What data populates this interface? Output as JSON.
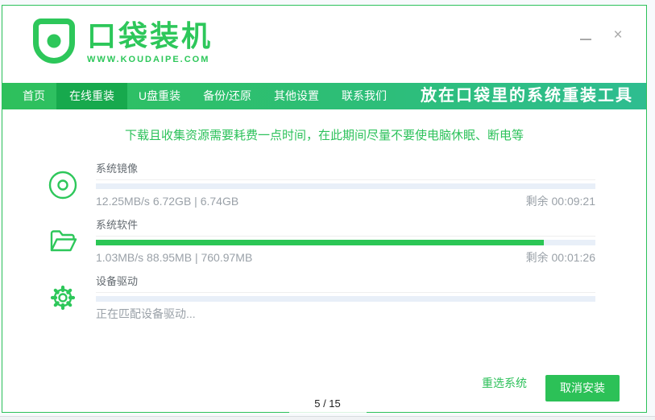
{
  "window": {
    "brand": {
      "title": "口袋装机",
      "url": "WWW.KOUDAIPE.COM"
    },
    "controls": {
      "close_icon": "×"
    }
  },
  "nav": {
    "tabs": [
      {
        "label": "首页",
        "active": false
      },
      {
        "label": "在线重装",
        "active": true
      },
      {
        "label": "U盘重装",
        "active": false
      },
      {
        "label": "备份/还原",
        "active": false
      },
      {
        "label": "其他设置",
        "active": false
      },
      {
        "label": "联系我们",
        "active": false
      }
    ],
    "slogan": "放在口袋里的系统重装工具"
  },
  "notice": "下载且收集资源需要耗费一点时间，在此期间尽量不要使电脑休眠、断电等",
  "tasks": [
    {
      "icon": "disc-icon",
      "title": "系统镜像",
      "status": "12.25MB/s 6.72GB | 6.74GB",
      "remaining": "剩余 00:09:21",
      "progress": 0
    },
    {
      "icon": "folder-icon",
      "title": "系统软件",
      "status": "1.03MB/s 88.95MB | 760.97MB",
      "remaining": "剩余 00:01:26",
      "progress": 89.6
    },
    {
      "icon": "gear-icon",
      "title": "设备驱动",
      "status": "正在匹配设备驱动...",
      "remaining": "",
      "progress": 0
    }
  ],
  "footer": {
    "reselect_label": "重选系统",
    "cancel_label": "取消安装",
    "pagination": "5 / 15"
  },
  "colors": {
    "accent_green": "#2dc75a",
    "nav_gradient_left": "#2ec05c",
    "nav_gradient_right": "#2ebd90",
    "active_tab": "#17a94d",
    "progress_track": "#e8eff8",
    "progress_fill": "#2bc655"
  }
}
